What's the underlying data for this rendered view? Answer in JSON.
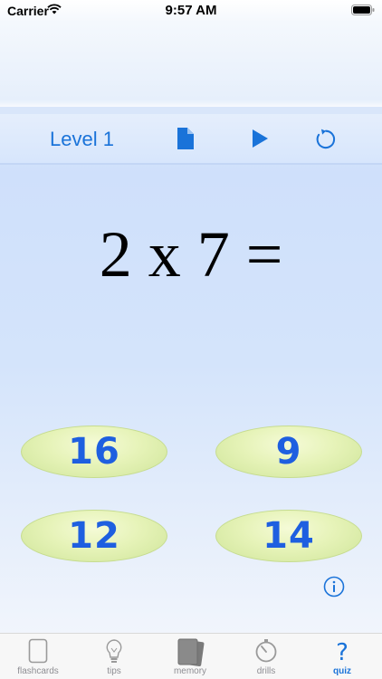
{
  "status_bar": {
    "carrier": "Carrier",
    "time": "9:57 AM"
  },
  "toolbar": {
    "level_label": "Level 1"
  },
  "question": {
    "text": "2 x 7 ="
  },
  "answers": [
    "16",
    "9",
    "12",
    "14"
  ],
  "tabs": [
    {
      "label": "flashcards"
    },
    {
      "label": "tips"
    },
    {
      "label": "memory"
    },
    {
      "label": "drills"
    },
    {
      "label": "quiz"
    }
  ],
  "colors": {
    "accent": "#1a73d9",
    "answer_text": "#1e5fe0",
    "answer_fill": "#e6f3b8"
  },
  "icons": [
    "wifi-icon",
    "battery-icon",
    "document-icon",
    "play-icon",
    "reload-icon",
    "info-icon",
    "flashcards-icon",
    "lightbulb-icon",
    "cards-stack-icon",
    "stopwatch-icon",
    "question-icon"
  ]
}
